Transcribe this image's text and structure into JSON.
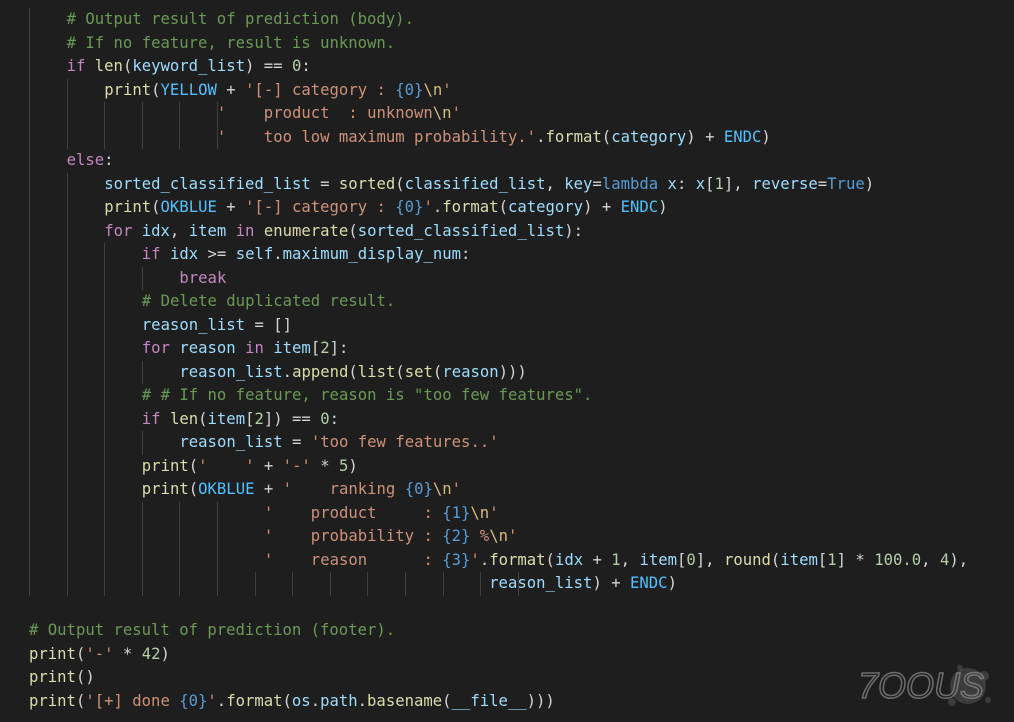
{
  "editor": {
    "colors": {
      "background": "#1e1e1e",
      "comment": "#6a9955",
      "keyword": "#569cd6",
      "control": "#c586c0",
      "function": "#dcdcaa",
      "variable": "#9cdcfe",
      "string": "#ce9178",
      "number": "#b5cea8",
      "constant": "#4fc1ff",
      "escape": "#d7ba7d",
      "plain": "#d4d4d4",
      "indent_guide": "#404040"
    },
    "lines": [
      {
        "indent": 1,
        "tokens": [
          [
            "comment",
            "# Output result of prediction (body)."
          ]
        ]
      },
      {
        "indent": 1,
        "tokens": [
          [
            "comment",
            "# If no feature, result is unknown."
          ]
        ]
      },
      {
        "indent": 1,
        "tokens": [
          [
            "control",
            "if"
          ],
          [
            "plain",
            " "
          ],
          [
            "func",
            "len"
          ],
          [
            "plain",
            "("
          ],
          [
            "var",
            "keyword_list"
          ],
          [
            "plain",
            ") == "
          ],
          [
            "number",
            "0"
          ],
          [
            "plain",
            ":"
          ]
        ]
      },
      {
        "indent": 2,
        "tokens": [
          [
            "func",
            "print"
          ],
          [
            "plain",
            "("
          ],
          [
            "const",
            "YELLOW"
          ],
          [
            "plain",
            " + "
          ],
          [
            "string",
            "'[-] category : "
          ],
          [
            "keyword",
            "{0}"
          ],
          [
            "esc",
            "\\n"
          ],
          [
            "string",
            "'"
          ]
        ]
      },
      {
        "indent": 2,
        "guides_extra": 4,
        "tokens": [
          [
            "plain",
            "            "
          ],
          [
            "string",
            "'    product  : unknown"
          ],
          [
            "esc",
            "\\n"
          ],
          [
            "string",
            "'"
          ]
        ]
      },
      {
        "indent": 2,
        "guides_extra": 4,
        "tokens": [
          [
            "plain",
            "            "
          ],
          [
            "string",
            "'    too low maximum probability.'"
          ],
          [
            "plain",
            "."
          ],
          [
            "func",
            "format"
          ],
          [
            "plain",
            "("
          ],
          [
            "var",
            "category"
          ],
          [
            "plain",
            ") + "
          ],
          [
            "const",
            "ENDC"
          ],
          [
            "plain",
            ")"
          ]
        ]
      },
      {
        "indent": 1,
        "tokens": [
          [
            "control",
            "else"
          ],
          [
            "plain",
            ":"
          ]
        ]
      },
      {
        "indent": 2,
        "tokens": [
          [
            "var",
            "sorted_classified_list"
          ],
          [
            "plain",
            " = "
          ],
          [
            "func",
            "sorted"
          ],
          [
            "plain",
            "("
          ],
          [
            "var",
            "classified_list"
          ],
          [
            "plain",
            ", "
          ],
          [
            "var",
            "key"
          ],
          [
            "plain",
            "="
          ],
          [
            "keyword",
            "lambda"
          ],
          [
            "plain",
            " "
          ],
          [
            "var",
            "x"
          ],
          [
            "plain",
            ": "
          ],
          [
            "var",
            "x"
          ],
          [
            "plain",
            "["
          ],
          [
            "number",
            "1"
          ],
          [
            "plain",
            "], "
          ],
          [
            "var",
            "reverse"
          ],
          [
            "plain",
            "="
          ],
          [
            "keyword",
            "True"
          ],
          [
            "plain",
            ")"
          ]
        ]
      },
      {
        "indent": 2,
        "tokens": [
          [
            "func",
            "print"
          ],
          [
            "plain",
            "("
          ],
          [
            "const",
            "OKBLUE"
          ],
          [
            "plain",
            " + "
          ],
          [
            "string",
            "'[-] category : "
          ],
          [
            "keyword",
            "{0}"
          ],
          [
            "string",
            "'"
          ],
          [
            "plain",
            "."
          ],
          [
            "func",
            "format"
          ],
          [
            "plain",
            "("
          ],
          [
            "var",
            "category"
          ],
          [
            "plain",
            ") + "
          ],
          [
            "const",
            "ENDC"
          ],
          [
            "plain",
            ")"
          ]
        ]
      },
      {
        "indent": 2,
        "tokens": [
          [
            "control",
            "for"
          ],
          [
            "plain",
            " "
          ],
          [
            "var",
            "idx"
          ],
          [
            "plain",
            ", "
          ],
          [
            "var",
            "item"
          ],
          [
            "plain",
            " "
          ],
          [
            "control",
            "in"
          ],
          [
            "plain",
            " "
          ],
          [
            "func",
            "enumerate"
          ],
          [
            "plain",
            "("
          ],
          [
            "var",
            "sorted_classified_list"
          ],
          [
            "plain",
            "):"
          ]
        ]
      },
      {
        "indent": 3,
        "tokens": [
          [
            "control",
            "if"
          ],
          [
            "plain",
            " "
          ],
          [
            "var",
            "idx"
          ],
          [
            "plain",
            " >= "
          ],
          [
            "var",
            "self"
          ],
          [
            "plain",
            "."
          ],
          [
            "var",
            "maximum_display_num"
          ],
          [
            "plain",
            ":"
          ]
        ]
      },
      {
        "indent": 4,
        "tokens": [
          [
            "control",
            "break"
          ]
        ]
      },
      {
        "indent": 3,
        "tokens": [
          [
            "comment",
            "# Delete duplicated result."
          ]
        ]
      },
      {
        "indent": 3,
        "tokens": [
          [
            "var",
            "reason_list"
          ],
          [
            "plain",
            " = []"
          ]
        ]
      },
      {
        "indent": 3,
        "tokens": [
          [
            "control",
            "for"
          ],
          [
            "plain",
            " "
          ],
          [
            "var",
            "reason"
          ],
          [
            "plain",
            " "
          ],
          [
            "control",
            "in"
          ],
          [
            "plain",
            " "
          ],
          [
            "var",
            "item"
          ],
          [
            "plain",
            "["
          ],
          [
            "number",
            "2"
          ],
          [
            "plain",
            "]:"
          ]
        ]
      },
      {
        "indent": 4,
        "tokens": [
          [
            "var",
            "reason_list"
          ],
          [
            "plain",
            "."
          ],
          [
            "func",
            "append"
          ],
          [
            "plain",
            "("
          ],
          [
            "func",
            "list"
          ],
          [
            "plain",
            "("
          ],
          [
            "func",
            "set"
          ],
          [
            "plain",
            "("
          ],
          [
            "var",
            "reason"
          ],
          [
            "plain",
            ")))"
          ]
        ]
      },
      {
        "indent": 3,
        "tokens": [
          [
            "comment",
            "# # If no feature, reason is \"too few features\"."
          ]
        ]
      },
      {
        "indent": 3,
        "tokens": [
          [
            "control",
            "if"
          ],
          [
            "plain",
            " "
          ],
          [
            "func",
            "len"
          ],
          [
            "plain",
            "("
          ],
          [
            "var",
            "item"
          ],
          [
            "plain",
            "["
          ],
          [
            "number",
            "2"
          ],
          [
            "plain",
            "]) == "
          ],
          [
            "number",
            "0"
          ],
          [
            "plain",
            ":"
          ]
        ]
      },
      {
        "indent": 4,
        "tokens": [
          [
            "var",
            "reason_list"
          ],
          [
            "plain",
            " = "
          ],
          [
            "string",
            "'too few features..'"
          ]
        ]
      },
      {
        "indent": 3,
        "tokens": [
          [
            "func",
            "print"
          ],
          [
            "plain",
            "("
          ],
          [
            "string",
            "'    '"
          ],
          [
            "plain",
            " + "
          ],
          [
            "string",
            "'-'"
          ],
          [
            "plain",
            " * "
          ],
          [
            "number",
            "5"
          ],
          [
            "plain",
            ")"
          ]
        ]
      },
      {
        "indent": 3,
        "tokens": [
          [
            "func",
            "print"
          ],
          [
            "plain",
            "("
          ],
          [
            "const",
            "OKBLUE"
          ],
          [
            "plain",
            " + "
          ],
          [
            "string",
            "'    ranking "
          ],
          [
            "keyword",
            "{0}"
          ],
          [
            "esc",
            "\\n"
          ],
          [
            "string",
            "'"
          ]
        ]
      },
      {
        "indent": 3,
        "guides_extra": 3,
        "tokens": [
          [
            "plain",
            "             "
          ],
          [
            "string",
            "'    product     : "
          ],
          [
            "keyword",
            "{1}"
          ],
          [
            "esc",
            "\\n"
          ],
          [
            "string",
            "'"
          ]
        ]
      },
      {
        "indent": 3,
        "guides_extra": 3,
        "tokens": [
          [
            "plain",
            "             "
          ],
          [
            "string",
            "'    probability : "
          ],
          [
            "keyword",
            "{2}"
          ],
          [
            "string",
            " %"
          ],
          [
            "esc",
            "\\n"
          ],
          [
            "string",
            "'"
          ]
        ]
      },
      {
        "indent": 3,
        "guides_extra": 3,
        "tokens": [
          [
            "plain",
            "             "
          ],
          [
            "string",
            "'    reason      : "
          ],
          [
            "keyword",
            "{3}"
          ],
          [
            "string",
            "'"
          ],
          [
            "plain",
            "."
          ],
          [
            "func",
            "format"
          ],
          [
            "plain",
            "("
          ],
          [
            "var",
            "idx"
          ],
          [
            "plain",
            " + "
          ],
          [
            "number",
            "1"
          ],
          [
            "plain",
            ", "
          ],
          [
            "var",
            "item"
          ],
          [
            "plain",
            "["
          ],
          [
            "number",
            "0"
          ],
          [
            "plain",
            "], "
          ],
          [
            "func",
            "round"
          ],
          [
            "plain",
            "("
          ],
          [
            "var",
            "item"
          ],
          [
            "plain",
            "["
          ],
          [
            "number",
            "1"
          ],
          [
            "plain",
            "] * "
          ],
          [
            "number",
            "100.0"
          ],
          [
            "plain",
            ", "
          ],
          [
            "number",
            "4"
          ],
          [
            "plain",
            "),"
          ]
        ]
      },
      {
        "indent": 3,
        "guides_extra": 11,
        "tokens": [
          [
            "plain",
            "                                     "
          ],
          [
            "var",
            "reason_list"
          ],
          [
            "plain",
            ") + "
          ],
          [
            "const",
            "ENDC"
          ],
          [
            "plain",
            ")"
          ]
        ]
      },
      {
        "indent": 0,
        "tokens": []
      },
      {
        "indent": 0,
        "tokens": [
          [
            "comment",
            "# Output result of prediction (footer)."
          ]
        ]
      },
      {
        "indent": 0,
        "tokens": [
          [
            "func",
            "print"
          ],
          [
            "plain",
            "("
          ],
          [
            "string",
            "'-'"
          ],
          [
            "plain",
            " * "
          ],
          [
            "number",
            "42"
          ],
          [
            "plain",
            ")"
          ]
        ]
      },
      {
        "indent": 0,
        "tokens": [
          [
            "func",
            "print"
          ],
          [
            "plain",
            "()"
          ]
        ]
      },
      {
        "indent": 0,
        "tokens": [
          [
            "func",
            "print"
          ],
          [
            "plain",
            "("
          ],
          [
            "string",
            "'[+] done "
          ],
          [
            "keyword",
            "{0}"
          ],
          [
            "string",
            "'"
          ],
          [
            "plain",
            "."
          ],
          [
            "func",
            "format"
          ],
          [
            "plain",
            "("
          ],
          [
            "var",
            "os"
          ],
          [
            "plain",
            "."
          ],
          [
            "var",
            "path"
          ],
          [
            "plain",
            "."
          ],
          [
            "func",
            "basename"
          ],
          [
            "plain",
            "("
          ],
          [
            "var",
            "__file__"
          ],
          [
            "plain",
            ")))"
          ]
        ]
      }
    ]
  },
  "watermark": {
    "text": "7OOUS",
    "icon": "splatter-logo-icon"
  }
}
